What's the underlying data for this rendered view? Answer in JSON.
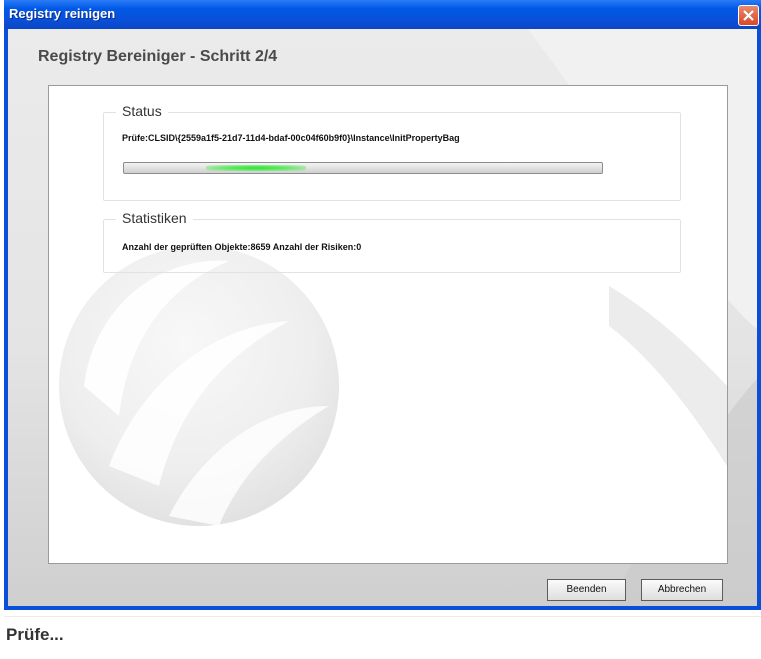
{
  "window": {
    "title": "Registry reinigen",
    "close_icon": "close-icon"
  },
  "wizard": {
    "heading": "Registry Bereiniger - Schritt 2/4"
  },
  "status_group": {
    "legend": "Status",
    "current_item": "Prüfe:CLSID\\{2559a1f5-21d7-11d4-bdaf-00c04f60b9f0}\\Instance\\InitPropertyBag",
    "progress_style": "indeterminate"
  },
  "stats_group": {
    "legend": "Statistiken",
    "summary": "Anzahl der geprüften Objekte:8659   Anzahl der Risiken:0"
  },
  "buttons": {
    "finish_label": "Beenden",
    "cancel_label": "Abbrechen"
  },
  "statusbar": {
    "text": "Prüfe..."
  },
  "colors": {
    "titlebar": "#0058e6",
    "close_button": "#d8482a",
    "progress_glow": "#2fe23a"
  }
}
